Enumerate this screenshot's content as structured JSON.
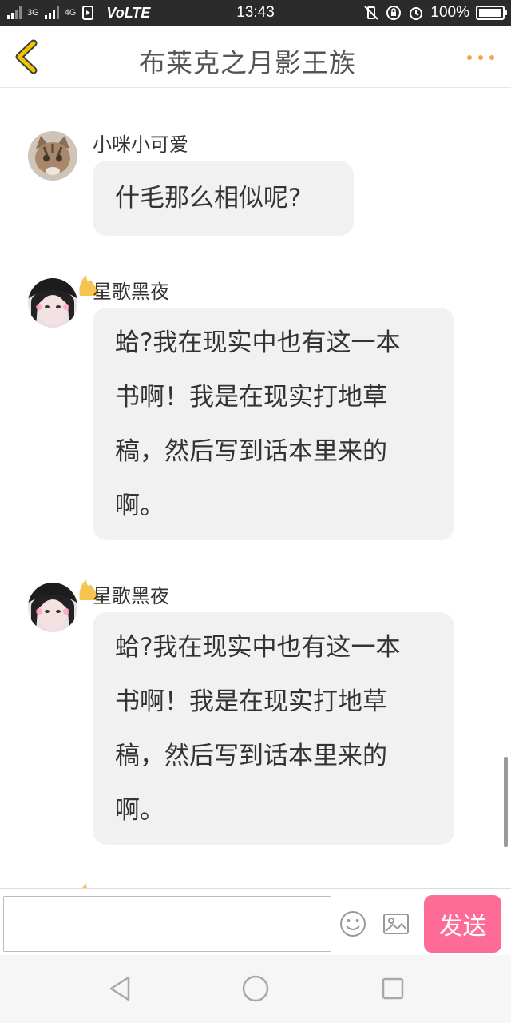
{
  "status_bar": {
    "network_left": "3G",
    "network_right": "4G",
    "volte": "VoLTE",
    "time": "13:43",
    "battery": "100%"
  },
  "header": {
    "title": "布莱克之月影王族"
  },
  "messages": [
    {
      "sender": "小咪小可爱",
      "lines": [
        "什毛那么相似呢?"
      ]
    },
    {
      "sender": "星歌黑夜",
      "lines": [
        "蛤?我在现实中也有这一本",
        "书啊！我是在现实打地草",
        "稿，然后写到话本里来的",
        "啊。"
      ]
    },
    {
      "sender": "星歌黑夜",
      "lines": [
        "蛤?我在现实中也有这一本",
        "书啊！我是在现实打地草",
        "稿，然后写到话本里来的",
        "啊。"
      ]
    }
  ],
  "input_bar": {
    "value": "",
    "send_label": "发送"
  },
  "icons": {
    "back": "chevron-left-icon",
    "more": "more-dots-icon",
    "emoji": "smiley-icon",
    "image": "image-icon"
  },
  "colors": {
    "accent": "#ff6b97",
    "back_arrow": "#f0c400",
    "more_dots": "#f7a04f",
    "crown": "#f5c451"
  }
}
